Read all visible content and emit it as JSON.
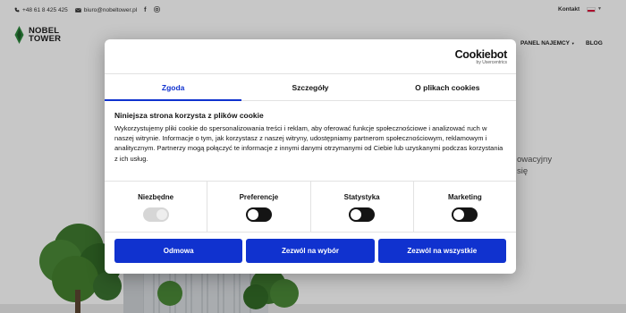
{
  "site": {
    "topbar": {
      "phone": "+48 61 8 425 425",
      "email": "biuro@nobeltower.pl",
      "facebook_icon": "facebook-icon",
      "instagram_icon": "instagram-icon",
      "contact": "Kontakt",
      "language_flag": "flag-pl-icon"
    },
    "logo": {
      "line1": "NOBEL",
      "line2": "TOWER"
    },
    "nav": {
      "panel": "PANEL NAJEMCY",
      "blog": "BLOG"
    },
    "hero": {
      "line1": "owacyjny",
      "line2": "się"
    }
  },
  "cookie": {
    "brand": {
      "name": "Cookiebot",
      "sub": "by Usercentrics"
    },
    "tabs": [
      "Zgoda",
      "Szczegóły",
      "O plikach cookies"
    ],
    "active_tab": "Zgoda",
    "heading": "Niniejsza strona korzysta z plików cookie",
    "description": "Wykorzystujemy pliki cookie do spersonalizowania treści i reklam, aby oferować funkcje społecznościowe i analizować ruch w naszej witrynie. Informacje o tym, jak korzystasz z naszej witryny, udostępniamy partnerom społecznościowym, reklamowym i analitycznym. Partnerzy mogą połączyć te informacje z innymi danymi otrzymanymi od Ciebie lub uzyskanymi podczas korzystania z ich usług.",
    "consents": [
      {
        "label": "Niezbędne",
        "state": "on-disabled"
      },
      {
        "label": "Preferencje",
        "state": "off"
      },
      {
        "label": "Statystyka",
        "state": "off"
      },
      {
        "label": "Marketing",
        "state": "off"
      }
    ],
    "buttons": {
      "deny": "Odmowa",
      "allow_selection": "Zezwól na wybór",
      "allow_all": "Zezwól na wszystkie"
    }
  },
  "colors": {
    "accent": "#1032cf",
    "toggle_off": "#141414",
    "toggle_disabled": "#d6d6d6",
    "logo_green": "#2e8b3e"
  }
}
